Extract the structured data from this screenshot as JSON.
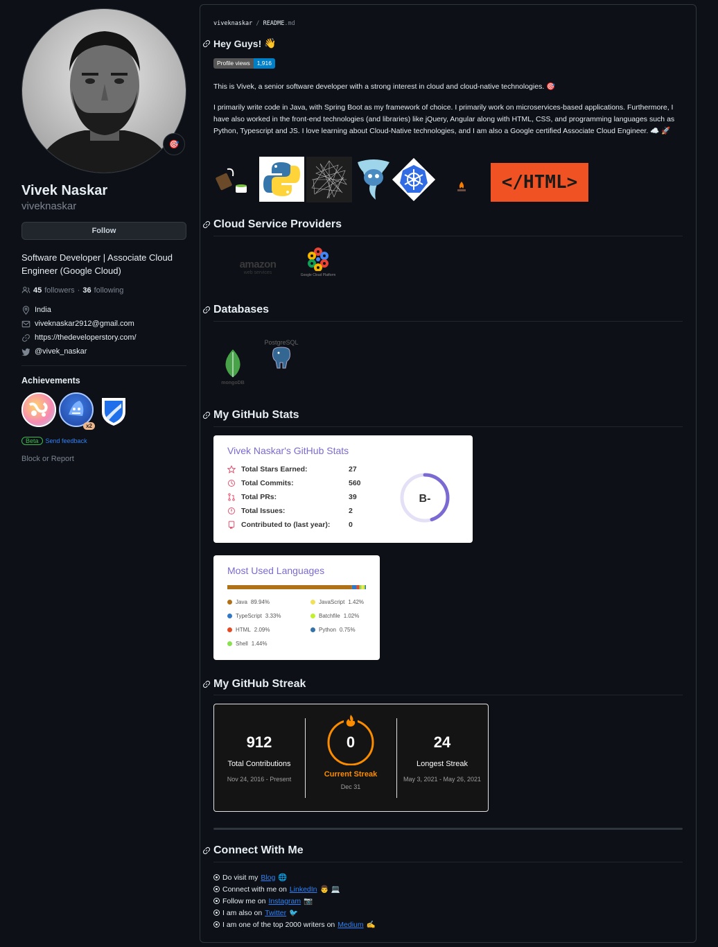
{
  "profile": {
    "name": "Vivek Naskar",
    "login": "viveknaskar",
    "follow_label": "Follow",
    "bio": "Software Developer | Associate Cloud Engineer (Google Cloud)",
    "followers_count": "45",
    "followers_label": "followers",
    "separator": "·",
    "following_count": "36",
    "following_label": "following",
    "location": "India",
    "email": "viveknaskar2912@gmail.com",
    "website": "https://thedeveloperstory.com/",
    "twitter": "@vivek_naskar",
    "status_emoji": "🎯"
  },
  "achievements": {
    "title": "Achievements",
    "multiplier": "x2",
    "beta": "Beta",
    "feedback": "Send feedback",
    "block": "Block or Report"
  },
  "readme": {
    "owner": "viveknaskar",
    "sep": "/",
    "file": "README",
    "ext": ".md",
    "greeting": "Hey Guys!",
    "greeting_emoji": "👋",
    "views_label": "Profile views",
    "views_count": "1,916",
    "intro": "This is Vivek, a senior software developer with a strong interest in cloud and cloud-native technologies. 🎯",
    "about": "I primarily write code in Java, with Spring Boot as my framework of choice. I primarily work on microservices-based applications. Furthermore, I have also worked in the front-end technologies (and libraries) like jQuery, Angular along with HTML, CSS, and programming languages such as Python, Typescript and JS. I love learning about Cloud-Native technologies, and I am also a Google certified Associate Cloud Engineer. ☁️ 🚀",
    "html_banner": "</HTML>",
    "h_cloud": "Cloud Service Providers",
    "aws_text": "amazon",
    "aws_sub": "web services",
    "gcp_text": "Google Cloud Platform",
    "h_db": "Databases",
    "mongo_text": "mongoDB",
    "pg_text": "PostgreSQL",
    "h_stats": "My GitHub Stats",
    "h_streak": "My GitHub Streak",
    "h_connect": "Connect With Me"
  },
  "stats_card": {
    "title": "Vivek Naskar's GitHub Stats",
    "rows": [
      {
        "label": "Total Stars Earned:",
        "value": "27"
      },
      {
        "label": "Total Commits:",
        "value": "560"
      },
      {
        "label": "Total PRs:",
        "value": "39"
      },
      {
        "label": "Total Issues:",
        "value": "2"
      },
      {
        "label": "Contributed to (last year):",
        "value": "0"
      }
    ],
    "grade": "B-",
    "grade_fraction": 0.45,
    "accent": "#7b6ad1"
  },
  "lang_card": {
    "title": "Most Used Languages",
    "languages": [
      {
        "name": "Java",
        "percent": "89.94%",
        "value": 89.94,
        "color": "#b07219"
      },
      {
        "name": "TypeScript",
        "percent": "3.33%",
        "value": 3.33,
        "color": "#3178c6"
      },
      {
        "name": "HTML",
        "percent": "2.09%",
        "value": 2.09,
        "color": "#e34c26"
      },
      {
        "name": "Shell",
        "percent": "1.44%",
        "value": 1.44,
        "color": "#89e051"
      },
      {
        "name": "JavaScript",
        "percent": "1.42%",
        "value": 1.42,
        "color": "#f1e05a"
      },
      {
        "name": "Batchfile",
        "percent": "1.02%",
        "value": 1.02,
        "color": "#c1f12e"
      },
      {
        "name": "Python",
        "percent": "0.75%",
        "value": 0.75,
        "color": "#3572a5"
      }
    ]
  },
  "streak_card": {
    "total": "912",
    "total_label": "Total Contributions",
    "total_range": "Nov 24, 2016 - Present",
    "current": "0",
    "current_label": "Current Streak",
    "current_date": "Dec 31",
    "longest": "24",
    "longest_label": "Longest Streak",
    "longest_range": "May 3, 2021 - May 26, 2021",
    "accent": "#fb8c00"
  },
  "connect": [
    {
      "prefix": "Do visit my ",
      "link": "Blog",
      "suffix": " 🌐"
    },
    {
      "prefix": "Connect with me on ",
      "link": "LinkedIn",
      "suffix": " 👨 💻"
    },
    {
      "prefix": "Follow me on ",
      "link": "Instagram",
      "suffix": " 📷"
    },
    {
      "prefix": "I am also on ",
      "link": "Twitter",
      "suffix": " 🐦"
    },
    {
      "prefix": "I am one of the top 2000 writers on ",
      "link": "Medium",
      "suffix": " ✍️"
    }
  ]
}
